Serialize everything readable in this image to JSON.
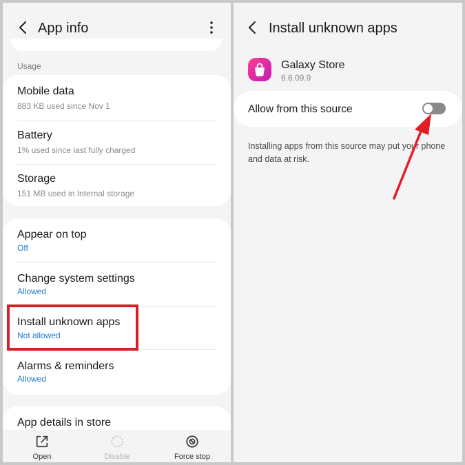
{
  "left": {
    "header": {
      "title": "App info",
      "back_icon": "chevron-left-icon",
      "menu_icon": "more-vert-icon"
    },
    "usage": {
      "section_label": "Usage",
      "items": [
        {
          "title": "Mobile data",
          "subtitle": "883 KB used since Nov 1"
        },
        {
          "title": "Battery",
          "subtitle": "1% used since last fully charged"
        },
        {
          "title": "Storage",
          "subtitle": "151 MB used in Internal storage"
        }
      ]
    },
    "permissions": {
      "items": [
        {
          "title": "Appear on top",
          "value": "Off"
        },
        {
          "title": "Change system settings",
          "value": "Allowed"
        },
        {
          "title": "Install unknown apps",
          "value": "Not allowed"
        },
        {
          "title": "Alarms & reminders",
          "value": "Allowed"
        }
      ]
    },
    "store": {
      "title": "App details in store"
    },
    "bottom_bar": [
      {
        "label": "Open",
        "icon": "open-external-icon",
        "enabled": true
      },
      {
        "label": "Disable",
        "icon": "disable-icon",
        "enabled": false
      },
      {
        "label": "Force stop",
        "icon": "force-stop-icon",
        "enabled": true
      }
    ],
    "highlight_color": "#d61f26"
  },
  "right": {
    "header": {
      "title": "Install unknown apps",
      "back_icon": "chevron-left-icon"
    },
    "app": {
      "name": "Galaxy Store",
      "version": "6.6.09.9",
      "icon": "galaxy-store-icon"
    },
    "setting": {
      "label": "Allow from this source",
      "enabled": false
    },
    "warning": "Installing apps from this source may put your phone and data at risk.",
    "arrow_color": "#e01e25"
  }
}
